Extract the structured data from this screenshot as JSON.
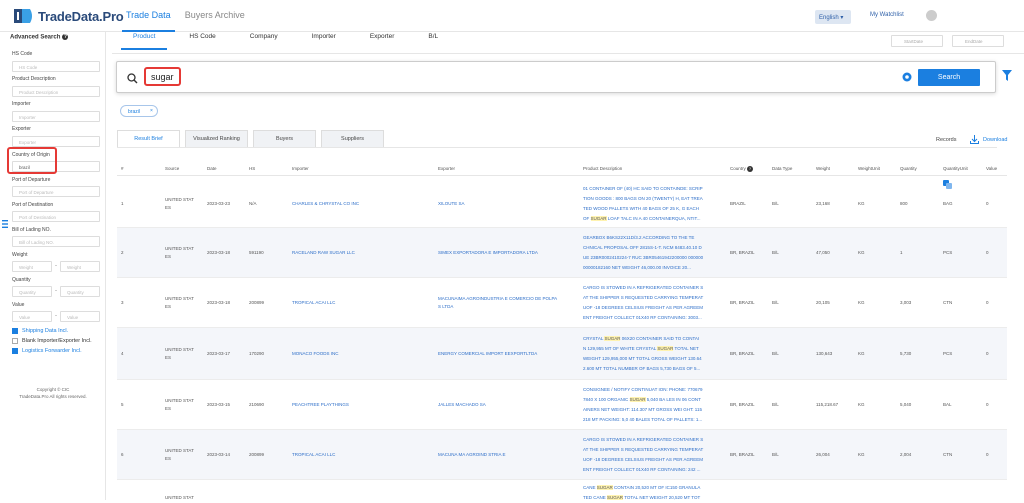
{
  "app": {
    "logo_text": "TradeData.Pro"
  },
  "top_nav": {
    "items": [
      "Trade Data",
      "Buyers Archive"
    ],
    "active": "Trade Data"
  },
  "header": {
    "language": "English ▾",
    "watchlist": "My Watchlist"
  },
  "sub_nav": {
    "items": [
      "Product",
      "HS Code",
      "Company",
      "Importer",
      "Exporter",
      "B/L"
    ],
    "active": "Product"
  },
  "dates": {
    "start_placeholder": "StartDate",
    "end_placeholder": "EndDate"
  },
  "search": {
    "value": "sugar",
    "button": "Search"
  },
  "filter_tag": "brazil",
  "tabs": [
    "Result Brief",
    "Visualized Ranking",
    "Buyers",
    "Suppliers"
  ],
  "records_label": "Records",
  "download_label": "Download",
  "sidebar": {
    "title": "Advanced Search",
    "hs_code_label": "HS Code",
    "hs_code_ph": "HS Code",
    "product_label": "Product Description",
    "product_ph": "Product Description",
    "importer_label": "Importer",
    "importer_ph": "Importer",
    "exporter_label": "Exporter",
    "exporter_ph": "Exporter",
    "country_label": "Country of Origin",
    "country_value": "brazil",
    "pod_label": "Port of Departure",
    "pod_ph": "Port of Departure",
    "pdest_label": "Port of Destination",
    "pdest_ph": "Port of Destination",
    "bl_label": "Bill of Lading NO.",
    "bl_ph": "Bill of Lading NO.",
    "weight_label": "Weight",
    "weight_ph": "Weight",
    "quantity_label": "Quantity",
    "quantity_ph": "Quantity",
    "value_label": "Value",
    "value_ph": "Value",
    "checkboxes": [
      {
        "label": "Shipping Data Incl.",
        "checked": true
      },
      {
        "label": "Blank Importer/Exporter Incl.",
        "checked": false
      },
      {
        "label": "Logistics Forwarder Incl.",
        "checked": true
      }
    ],
    "copyright_1": "Copyright © CIC",
    "copyright_2": "TradeData.Pro All rights reserved."
  },
  "table": {
    "headers": [
      "#",
      "Source",
      "Date",
      "HS",
      "Importer",
      "Exporter",
      "Product Description",
      "Country",
      "Data Type",
      "Weight",
      "WeightUnit",
      "Quantity",
      "QuantityUnit",
      "Value"
    ],
    "rows": [
      {
        "n": "1",
        "src1": "UNITED STAT",
        "src2": "ES",
        "date": "2023-03-23",
        "hs": "N/A",
        "importer": "CHARLES & CHRYSTAL CO INC",
        "exporter": "XILOUTE SA",
        "d1": "01 CONTAINER OF (40) HC SAID TO CONTAINDE: SCRIP",
        "d2": "TION GOODS : 800 BAGS ON 20 (TWENTY) H, EAT TREA",
        "d3": "TED WOOD PALLETS WITH 40 BAGS OF 25 K, G EACH",
        "d4a": "OF ",
        "d4b": "SUGAR",
        "d4c": " LOAF TALC IN A 40 CONTAINERQUA, NTIT...",
        "country": "BRAZIL",
        "type": "B/L",
        "weight": "23,168",
        "wu": "KG",
        "qty": "800",
        "qu": "BAG",
        "value": "0"
      },
      {
        "n": "2",
        "src1": "UNITED STAT",
        "src2": "ES",
        "date": "2023-03-18",
        "hs": "591190",
        "importer": "RACELAND RAW SUGAR LLC",
        "exporter": "SIMEX EXPORTADORA E IMPORTADORA LTDA",
        "d1": "GEARBOX B6KS22X11D/3.2 ACCORDING TO THE TE",
        "d2": "CHNICAL PROPOSAL OFF 2815S-1-T. NCM 8483.40.10 D",
        "d3": "UE 23BR0002410224-7 RUC 3BR05461942200000 000000",
        "d4a": "00000182160 NET WEIGHT 46,000.00 INVOICE 20...",
        "d4b": "",
        "d4c": "",
        "country": "BR, BRAZIL",
        "type": "B/L",
        "weight": "47,050",
        "wu": "KG",
        "qty": "1",
        "qu": "PCS",
        "value": "0"
      },
      {
        "n": "3",
        "src1": "UNITED STAT",
        "src2": "ES",
        "date": "2023-03-18",
        "hs": "200899",
        "importer": "TROPICAL ACAI LLC",
        "exporter": "MACUNAIMA AGROINDUSTRIA E COMERCIO DE POLPA",
        "exporter2": "S LTDA",
        "d1": "CARGO IS STOWED IN A REFRIGERATED CONTAINER S",
        "d2": "AT THE SHIPPER S REQUESTED CARRYING TEMPERAT",
        "d3": "UOF -18 DEGREES CELSIUS FREIGHT AS PER AGREEM",
        "d4a": "ENT FREIGHT COLLECT 01X40 RF CONTAINING: 3003...",
        "d4b": "",
        "d4c": "",
        "country": "BR, BRAZIL",
        "type": "B/L",
        "weight": "20,105",
        "wu": "KG",
        "qty": "3,003",
        "qu": "CTN",
        "value": "0"
      },
      {
        "n": "4",
        "src1": "UNITED STAT",
        "src2": "ES",
        "date": "2023-03-17",
        "hs": "170290",
        "importer": "MONACO FOODS INC",
        "exporter": "ENERGY COMERCIAL IMPORT EEXPORTLTDA",
        "d1a": "CRYSTAL ",
        "d1b": "SUGAR",
        "d1c": " 06X20 CONTAINER SAID TO CONTAI",
        "d2a": "N 129,955 MT OF WHITE CRYSTAL ",
        "d2b": "SUGAR",
        "d2c": " TOTAL NET",
        "d3": "WEIGHT 129,955,000 MT TOTAL GROSS WEIGHT 130.64",
        "d4a": "2.600 MT TOTAL NUMBER OF BAGS 5,730 BAGS OF 5...",
        "d4b": "",
        "d4c": "",
        "country": "BR, BRAZIL",
        "type": "B/L",
        "weight": "130,643",
        "wu": "KG",
        "qty": "5,730",
        "qu": "PCS",
        "value": "0"
      },
      {
        "n": "5",
        "src1": "UNITED STAT",
        "src2": "ES",
        "date": "2023-03-15",
        "hs": "210690",
        "importer": "PEACHTREE PLAYTHINGS",
        "exporter": "JALLES MACHADO SA",
        "d1": "CONSIGNEE / NOTIFY CONTINUAT ION: PHONE: 770679",
        "d2a": "7840 X 100 ORGANIC ",
        "d2b": "SUGAR",
        "d2c": " 5,040 BA LES IN 06 CONT",
        "d3": "AINERS NET WEIGHT: 114.307 MT GROSS WEI GHT: 115",
        "d4a": "218 MT PACKING: 5,0 40 BALES TOTAL OF PALLETS: 1...",
        "d4b": "",
        "d4c": "",
        "country": "BR, BRAZIL",
        "type": "B/L",
        "weight": "115,218.67",
        "wu": "KG",
        "qty": "5,040",
        "qu": "BAL",
        "value": "0"
      },
      {
        "n": "6",
        "src1": "UNITED STAT",
        "src2": "ES",
        "date": "2023-03-14",
        "hs": "200899",
        "importer": "TROPICAL ACAI LLC",
        "exporter": "MACUNA MA AGROIND STRIA E",
        "d1": "CARGO IS STOWED IN A REFRIGERATED CONTAINER S",
        "d2": "AT THE SHIPPER S REQUESTED CARRYING TEMPERAT",
        "d3": "UOF -18 DEGREES CELSIUS FREIGHT AS PER AGREEM",
        "d4a": "ENT FREIGHT COLLECT 01X40 RF CONTAINING: 242 ...",
        "d4b": "",
        "d4c": "",
        "country": "BR, BRAZIL",
        "type": "B/L",
        "weight": "26,004",
        "wu": "KG",
        "qty": "2,004",
        "qu": "CTN",
        "value": "0"
      },
      {
        "src1": "UNITED STAT",
        "d1a": "CANE ",
        "d1b": "SUGAR",
        "d1c": " CONTAIN 20,520 MT OF IC150 GRANULA",
        "d2a": "TED CANE ",
        "d2b": "SUGAR",
        "d2c": " TOTAL NET WEIGHT 20,520 MT TOT"
      }
    ]
  }
}
